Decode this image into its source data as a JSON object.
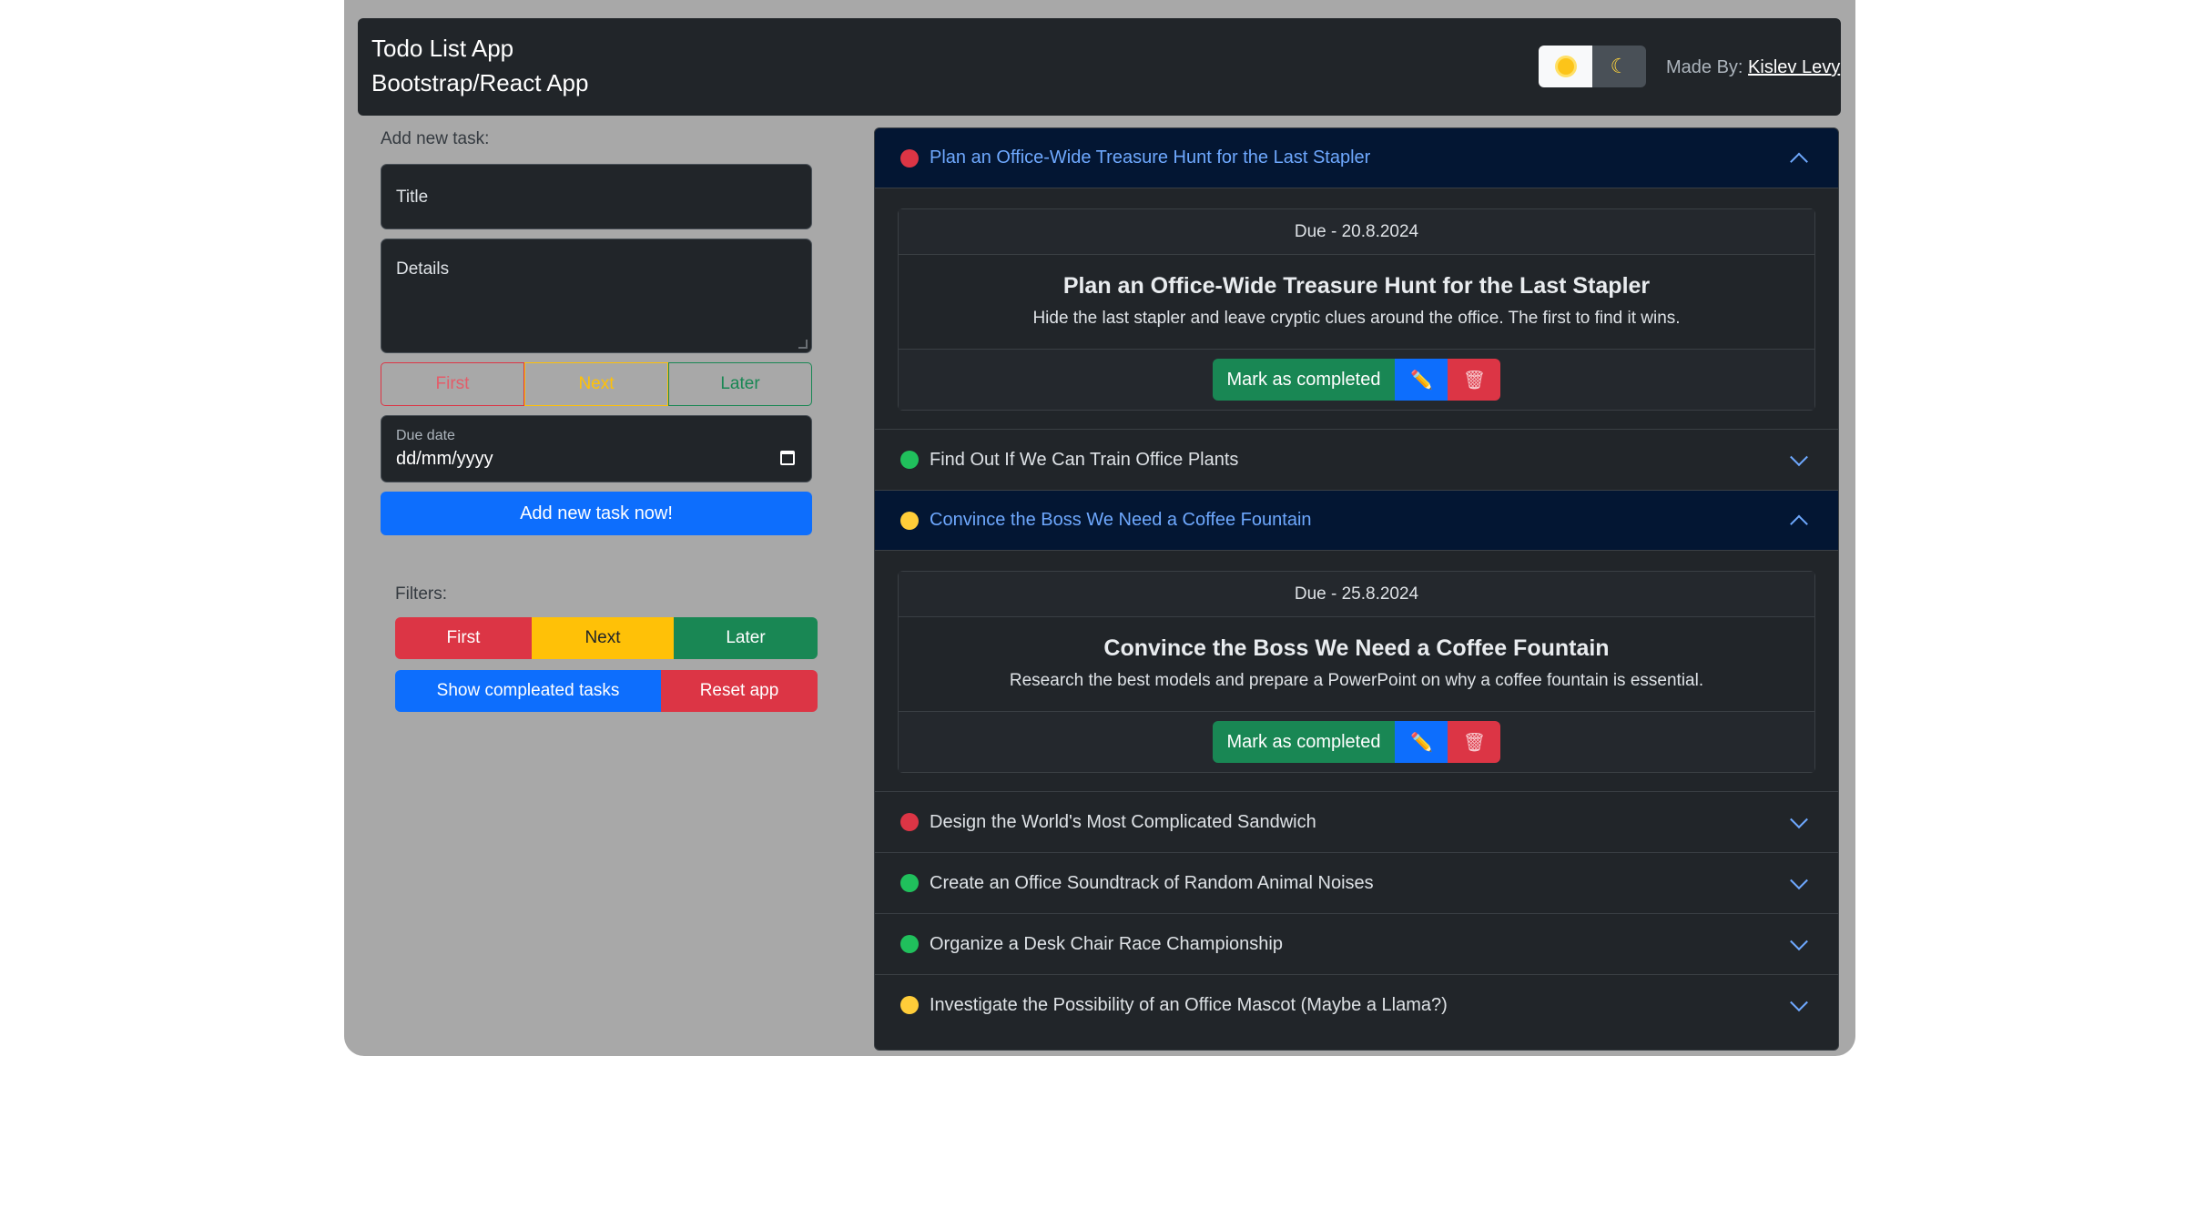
{
  "header": {
    "title_line1": "Todo List App",
    "title_line2": "Bootstrap/React App",
    "credit_prefix": "Made By:",
    "credit_name": "Kislev Levy"
  },
  "form": {
    "label": "Add new task:",
    "title_placeholder": "Title",
    "details_placeholder": "Details",
    "priorities": [
      "First",
      "Next",
      "Later"
    ],
    "due_label": "Due date",
    "due_placeholder": "dd/mm/yyyy",
    "submit_label": "Add new task now!"
  },
  "filters": {
    "label": "Filters:",
    "buttons": [
      "First",
      "Next",
      "Later"
    ],
    "show_completed": "Show compleated tasks",
    "reset": "Reset app"
  },
  "colors": {
    "first": "#dc3545",
    "next": "#ffc107",
    "later": "#198754",
    "primary": "#0d6efd"
  },
  "tasks": [
    {
      "title": "Plan an Office-Wide Treasure Hunt for the Last Stapler",
      "priority": "first",
      "expanded": true,
      "due": "Due - 20.8.2024",
      "details": "Hide the last stapler and leave cryptic clues around the office. The first to find it wins."
    },
    {
      "title": "Find Out If We Can Train Office Plants",
      "priority": "later",
      "expanded": false
    },
    {
      "title": "Convince the Boss We Need a Coffee Fountain",
      "priority": "next",
      "expanded": true,
      "due": "Due - 25.8.2024",
      "details": "Research the best models and prepare a PowerPoint on why a coffee fountain is essential."
    },
    {
      "title": "Design the World's Most Complicated Sandwich",
      "priority": "first",
      "expanded": false
    },
    {
      "title": "Create an Office Soundtrack of Random Animal Noises",
      "priority": "later",
      "expanded": false
    },
    {
      "title": "Organize a Desk Chair Race Championship",
      "priority": "later",
      "expanded": false
    },
    {
      "title": "Investigate the Possibility of an Office Mascot (Maybe a Llama?)",
      "priority": "next",
      "expanded": false
    }
  ],
  "card_actions": {
    "complete_label": "Mark as completed",
    "edit_icon": "pencil-icon",
    "delete_icon": "wastebasket-icon"
  }
}
